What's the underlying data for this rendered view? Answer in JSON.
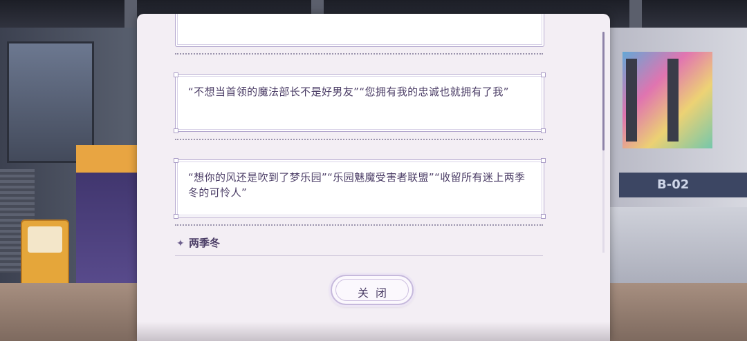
{
  "background": {
    "sign_text": "B-02"
  },
  "dialog": {
    "messages": [
      {
        "text": ""
      },
      {
        "text": "“不想当首领的魔法部长不是好男友”“您拥有我的忠诚也就拥有了我”"
      },
      {
        "text": "“想你的风还是吹到了梦乐园”“乐园魅魔受害者联盟”“收留所有迷上两季冬的可怜人”"
      }
    ],
    "author": {
      "icon": "sparkle-icon",
      "name": "两季冬"
    },
    "close_label": "关闭"
  },
  "colors": {
    "panel_bg": "#f3eef4",
    "text": "#4b3d66",
    "accent": "#b4a8ce"
  }
}
